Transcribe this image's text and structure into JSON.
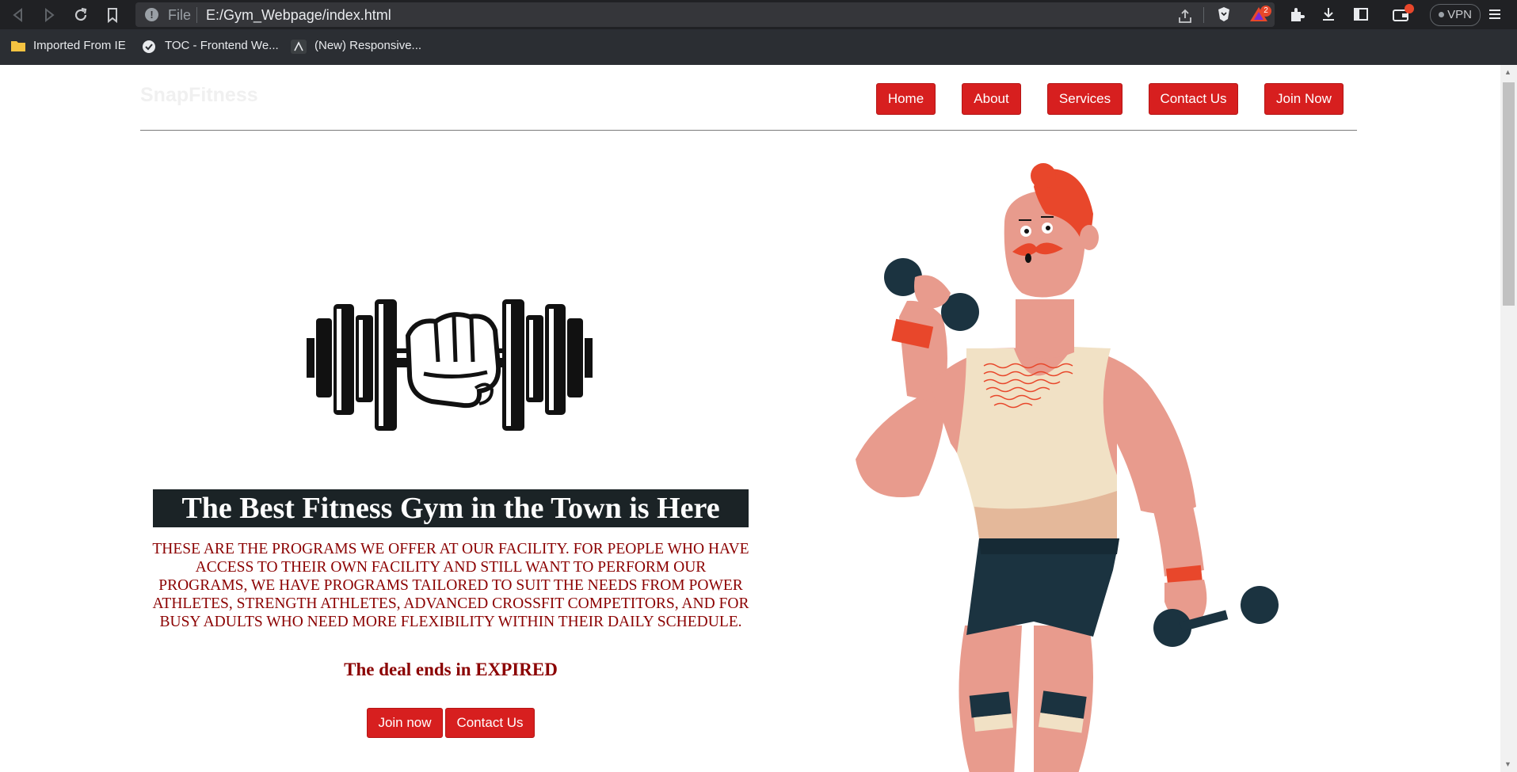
{
  "browser": {
    "url_scheme": "File",
    "url": "E:/Gym_Webpage/index.html",
    "notification_count": "2",
    "vpn_label": "VPN",
    "bookmarks": [
      {
        "label": "Imported From IE",
        "icon": "folder-icon"
      },
      {
        "label": "TOC - Frontend We...",
        "icon": "site-icon"
      },
      {
        "label": "(New) Responsive...",
        "icon": "site-icon"
      }
    ]
  },
  "site": {
    "brand": "SnapFitness",
    "nav": [
      {
        "label": "Home"
      },
      {
        "label": "About"
      },
      {
        "label": "Services"
      },
      {
        "label": "Contact Us"
      },
      {
        "label": "Join Now"
      }
    ]
  },
  "hero": {
    "headline": "The Best Fitness Gym in the Town is Here",
    "description": "THESE ARE THE PROGRAMS WE OFFER AT OUR FACILITY. FOR PEOPLE WHO HAVE ACCESS TO THEIR OWN FACILITY AND STILL WANT TO PERFORM OUR PROGRAMS, WE HAVE PROGRAMS TAILORED TO SUIT THE NEEDS FROM POWER ATHLETES, STRENGTH ATHLETES, ADVANCED CROSSFIT COMPETITORS, AND FOR BUSY ADULTS WHO NEED MORE FLEXIBILITY WITHIN THEIR DAILY SCHEDULE.",
    "deal_text": "The deal ends in EXPIRED",
    "join_button": "Join now",
    "contact_button": "Contact Us"
  },
  "colors": {
    "accent": "#d71f1f",
    "headline_bg": "#1b2326",
    "text_dark_red": "#8b0000",
    "chrome_bg": "#202124"
  },
  "icons": [
    "back-icon",
    "forward-icon",
    "reload-icon",
    "bookmark-icon",
    "info-icon",
    "share-icon",
    "brave-shield-icon",
    "brave-rewards-icon",
    "extensions-icon",
    "download-icon",
    "sidebar-icon",
    "wallet-icon",
    "menu-icon",
    "dumbbell-fist-icon",
    "muscle-man-illustration"
  ]
}
